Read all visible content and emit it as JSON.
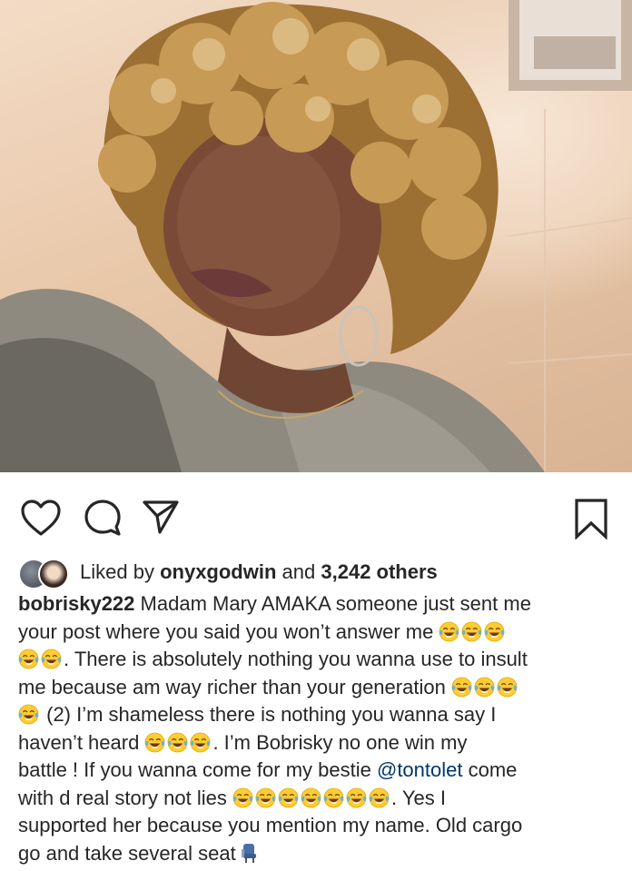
{
  "post": {
    "image_alt": "Selfie of a woman with curly blonde hair"
  },
  "actions": {
    "like_icon": "heart-icon",
    "comment_icon": "comment-icon",
    "share_icon": "paper-plane-icon",
    "save_icon": "bookmark-icon"
  },
  "likes": {
    "prefix": "Liked by",
    "user": "onyxgodwin",
    "and": "and",
    "count": "3,242 others"
  },
  "caption": {
    "username": "bobrisky222",
    "lines": {
      "l1": "Madam Mary AMAKA someone just sent me",
      "l2": "your post where you said you won’t answer me",
      "l3": ". There is absolutely nothing you wanna use to insult",
      "l4": "me because am way richer than your generation",
      "l5": " (2) I’m shameless there is nothing you wanna say I",
      "l6a": "haven’t heard",
      "l6b": ". I’m Bobrisky no one win my",
      "l7": "battle ! If you wanna come for my bestie",
      "l7_mention": "@tontolet",
      "l7_end": "come",
      "l8a": "with d real story not lies",
      "l8b": ". Yes I",
      "l9": "supported her because you mention my name. Old cargo",
      "l10": "go and take several seat"
    },
    "emoji_name": "face-with-tears-of-joy-emoji",
    "seat_emoji_name": "seat-emoji"
  }
}
